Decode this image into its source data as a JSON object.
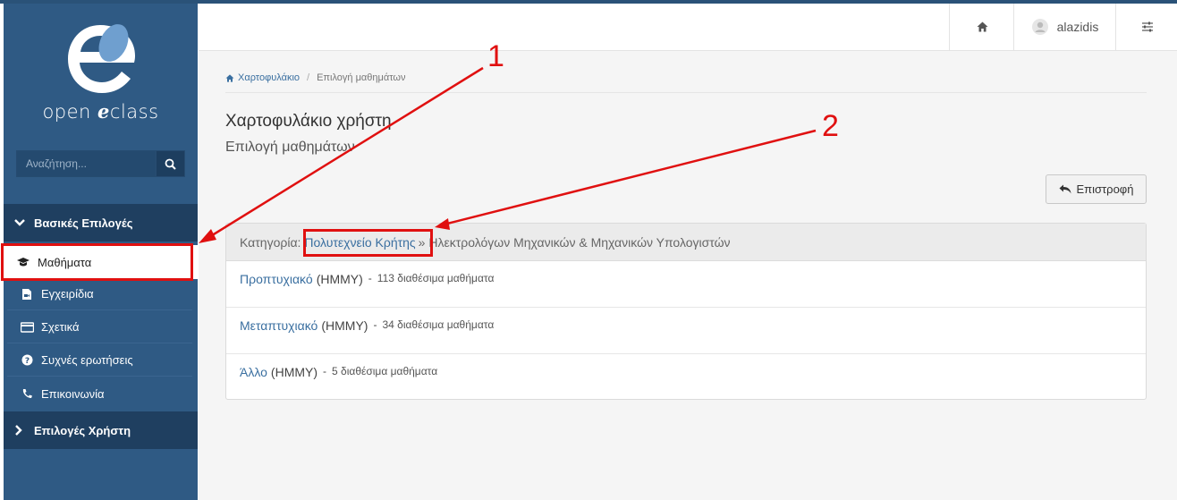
{
  "app": {
    "logo_word1": "open",
    "logo_word2": "e",
    "logo_word3": "class"
  },
  "search": {
    "placeholder": "Αναζήτηση..."
  },
  "sidebar": {
    "section1": "Βασικές Επιλογές",
    "items": [
      {
        "label": "Μαθήματα",
        "icon": "graduation-cap-icon",
        "active": true
      },
      {
        "label": "Εγχειρίδια",
        "icon": "video-file-icon"
      },
      {
        "label": "Σχετικά",
        "icon": "credit-card-icon"
      },
      {
        "label": "Συχνές ερωτήσεις",
        "icon": "question-circle-icon"
      },
      {
        "label": "Επικοινωνία",
        "icon": "phone-icon"
      }
    ],
    "section2": "Επιλογές Χρήστη"
  },
  "topbar": {
    "username": "alazidis"
  },
  "breadcrumb": {
    "home": "Χαρτοφυλάκιο",
    "current": "Επιλογή μαθημάτων"
  },
  "page": {
    "title": "Χαρτοφυλάκιο χρήστη",
    "subtitle": "Επιλογή μαθημάτων"
  },
  "back_button": "Επιστροφή",
  "category": {
    "prefix": "Κατηγορία:",
    "link": "Πολυτεχνείο Κρήτης",
    "rest": "» Ηλεκτρολόγων Μηχανικών & Μηχανικών Υπολογιστών"
  },
  "rows": [
    {
      "link": "Προπτυχιακό",
      "code": "(ΗΜΜΥ)",
      "count": "113 διαθέσιμα μαθήματα"
    },
    {
      "link": "Μεταπτυχιακό",
      "code": "(ΗΜΜΥ)",
      "count": "34 διαθέσιμα μαθήματα"
    },
    {
      "link": "Άλλο",
      "code": "(ΗΜΜΥ)",
      "count": "5 διαθέσιμα μαθήματα"
    }
  ],
  "annotations": {
    "n1": "1",
    "n2": "2"
  },
  "colors": {
    "sidebar": "#2f5a84",
    "accent_red": "#e01010",
    "link": "#3a6fa0"
  }
}
